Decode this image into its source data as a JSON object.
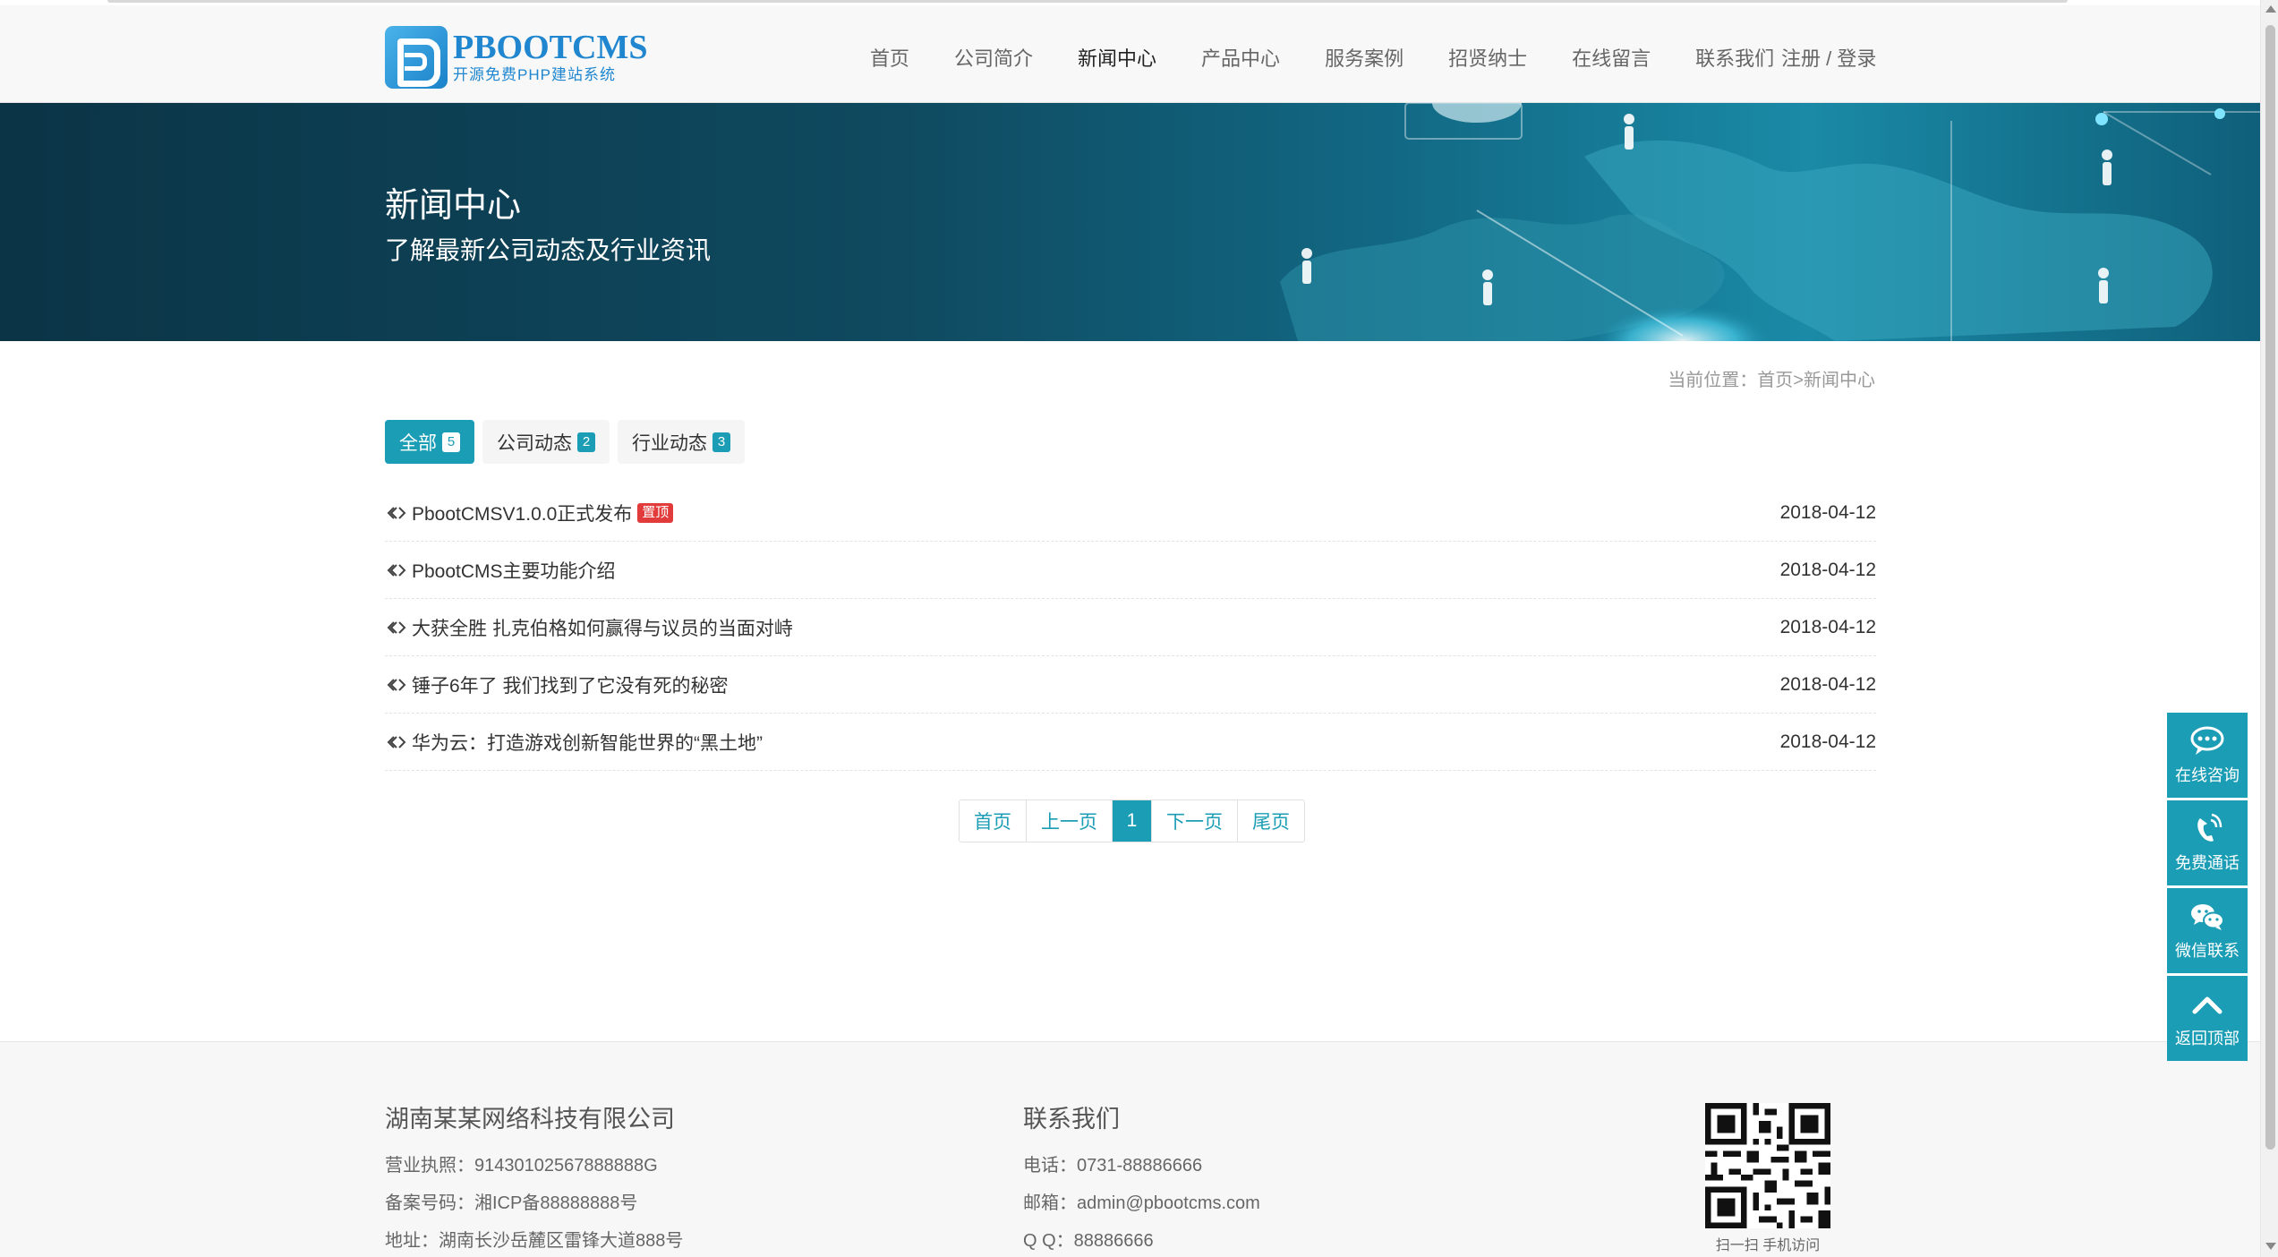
{
  "header": {
    "logo_name": "PBOOTCMS",
    "logo_sub": "开源免费PHP建站系统",
    "nav": [
      "首页",
      "公司简介",
      "新闻中心",
      "产品中心",
      "服务案例",
      "招贤纳士",
      "在线留言",
      "联系我们"
    ],
    "active_nav": "新闻中心",
    "login": "注册 / 登录"
  },
  "banner": {
    "title": "新闻中心",
    "subtitle": "了解最新公司动态及行业资讯"
  },
  "breadcrumb": "当前位置：首页>新闻中心",
  "tabs": [
    {
      "label": "全部",
      "count": "5"
    },
    {
      "label": "公司动态",
      "count": "2"
    },
    {
      "label": "行业动态",
      "count": "3"
    }
  ],
  "news": [
    {
      "title": "PbootCMSV1.0.0正式发布",
      "badge": "置顶",
      "date": "2018-04-12"
    },
    {
      "title": "PbootCMS主要功能介绍",
      "date": "2018-04-12"
    },
    {
      "title": "大获全胜 扎克伯格如何赢得与议员的当面对峙",
      "date": "2018-04-12"
    },
    {
      "title": "锤子6年了 我们找到了它没有死的秘密",
      "date": "2018-04-12"
    },
    {
      "title": "华为云：打造游戏创新智能世界的“黑土地”",
      "date": "2018-04-12"
    }
  ],
  "pager": {
    "first": "首页",
    "prev": "上一页",
    "current": "1",
    "next": "下一页",
    "last": "尾页"
  },
  "footer": {
    "company": "湖南某某网络科技有限公司",
    "license": "营业执照：91430102567888888G",
    "icp": "备案号码：湘ICP备88888888号",
    "address": "地址：湖南长沙岳麓区雷锋大道888号",
    "contact_title": "联系我们",
    "phone": "电话：0731-88886666",
    "email": "邮箱：admin@pbootcms.com",
    "qq": "Q  Q：88886666",
    "qr_caption": "扫一扫 手机访问"
  },
  "float_bar": {
    "consult": "在线咨询",
    "call": "免费通话",
    "wechat": "微信联系",
    "top": "返回顶部"
  },
  "colors": {
    "accent": "#1b9db5",
    "badge": "#e23b3b",
    "logo": "#1f86cf"
  },
  "icons": [
    "comment-icon",
    "phone-icon",
    "wechat-icon",
    "chevron-up-icon",
    "double-arrow-icon",
    "qr-code-icon"
  ]
}
